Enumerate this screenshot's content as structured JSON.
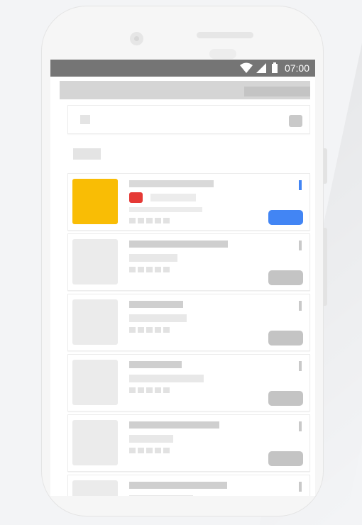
{
  "colors": {
    "page_background": "#f3f4f6",
    "phone_body": "#f6f6f6",
    "status_bar": "#757575",
    "skeleton": "#cfcfcf",
    "active_thumbnail": "#f9bd05",
    "active_badge": "#e53935",
    "active_action": "#4285f4"
  },
  "status_bar": {
    "time": "07:00",
    "icons": [
      "wifi-icon",
      "cellular-signal-icon",
      "battery-icon"
    ]
  },
  "list": {
    "cards": [
      {
        "state": "active",
        "has_badge": true
      },
      {
        "state": "placeholder",
        "has_badge": false
      },
      {
        "state": "placeholder",
        "has_badge": false
      },
      {
        "state": "placeholder",
        "has_badge": false
      },
      {
        "state": "placeholder",
        "has_badge": false
      },
      {
        "state": "placeholder",
        "has_badge": false
      }
    ]
  }
}
